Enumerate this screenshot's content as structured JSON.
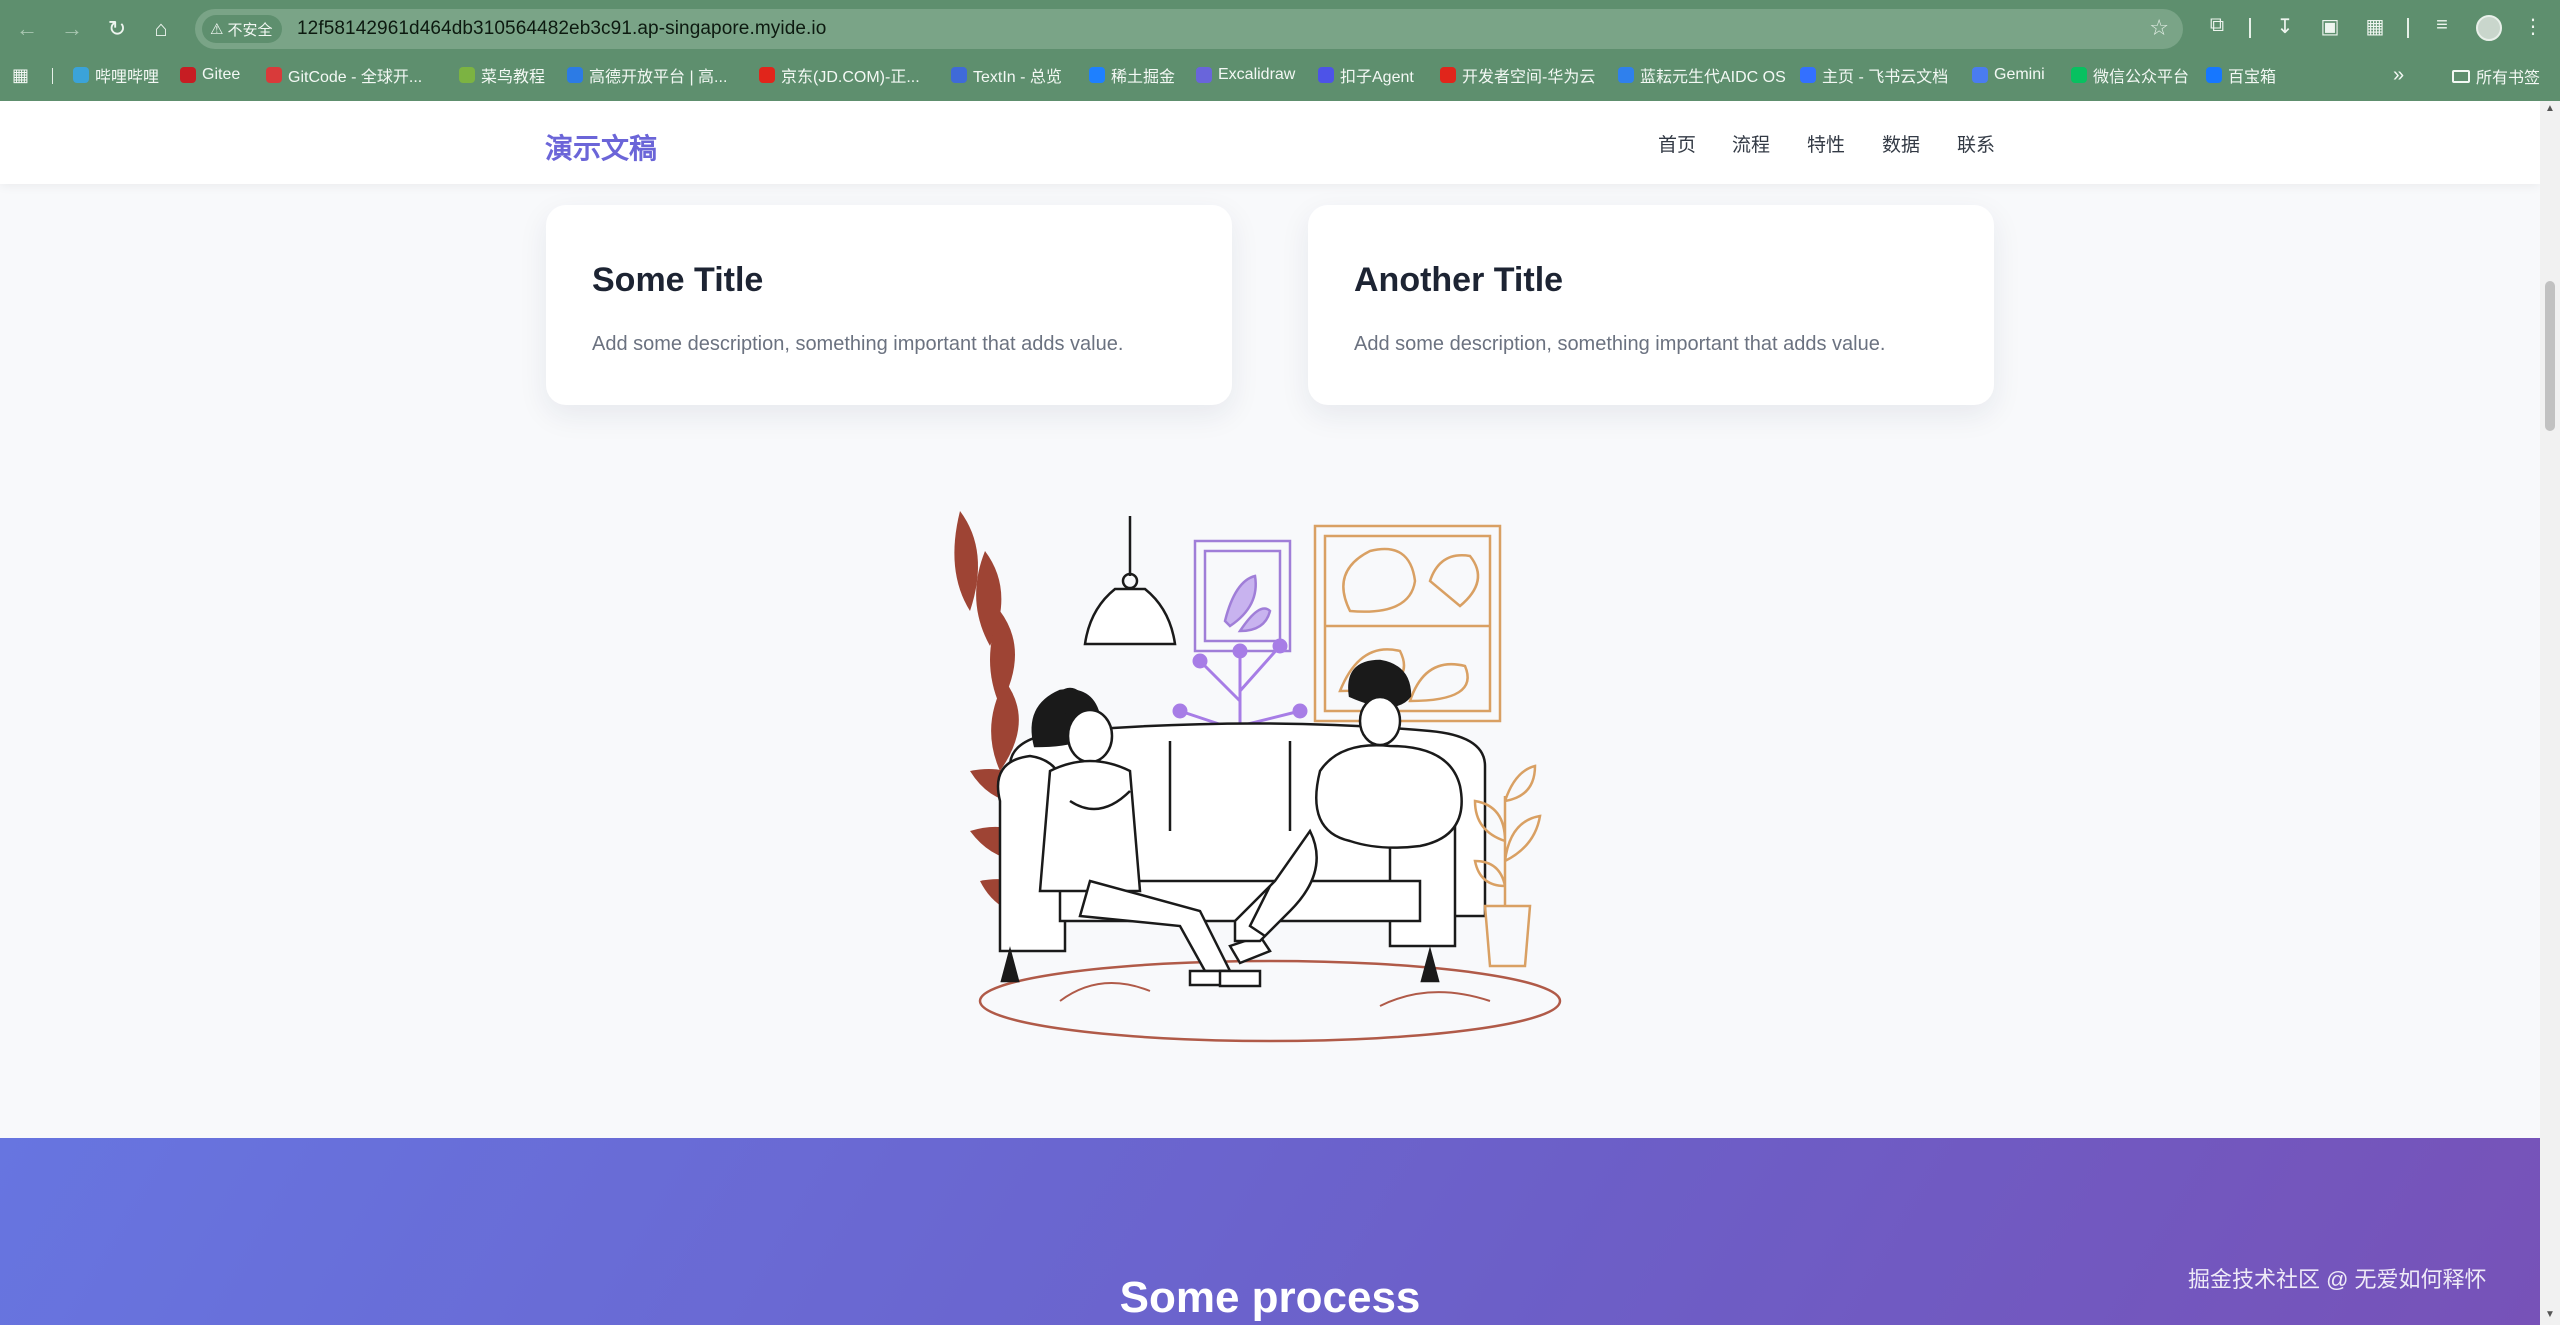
{
  "browser": {
    "security_label": "不安全",
    "url": "12f58142961d464db310564482eb3c91.ap-singapore.myide.io",
    "bookmarks": [
      {
        "label": "哔哩哔哩",
        "color": "#3ba3d9"
      },
      {
        "label": "Gitee",
        "color": "#c71d23"
      },
      {
        "label": "GitCode - 全球开...",
        "color": "#d93a3a"
      },
      {
        "label": "菜鸟教程",
        "color": "#7cb342"
      },
      {
        "label": "高德开放平台 | 高...",
        "color": "#2c7be5"
      },
      {
        "label": "京东(JD.COM)-正...",
        "color": "#e1251b"
      },
      {
        "label": "TextIn - 总览",
        "color": "#3f6ad8"
      },
      {
        "label": "稀土掘金",
        "color": "#1e80ff"
      },
      {
        "label": "Excalidraw",
        "color": "#6965db"
      },
      {
        "label": "扣子Agent",
        "color": "#4d53e8"
      },
      {
        "label": "开发者空间-华为云",
        "color": "#e1251b"
      },
      {
        "label": "蓝耘元生代AIDC OS",
        "color": "#2f80ed"
      },
      {
        "label": "主页 - 飞书云文档",
        "color": "#3370ff"
      },
      {
        "label": "Gemini",
        "color": "#4a7cf0"
      },
      {
        "label": "微信公众平台",
        "color": "#07c160"
      },
      {
        "label": "百宝箱",
        "color": "#1677ff"
      }
    ],
    "all_bookmarks_label": "所有书签"
  },
  "site": {
    "logo": "演示文稿",
    "nav": [
      "首页",
      "流程",
      "特性",
      "数据",
      "联系"
    ]
  },
  "cards": [
    {
      "title": "Some Title",
      "desc": "Add some description, something important that adds value."
    },
    {
      "title": "Another Title",
      "desc": "Add some description, something important that adds value."
    }
  ],
  "process": {
    "heading": "Some process"
  },
  "watermark": "掘金技术社区 @ 无爱如何释怀",
  "colors": {
    "accent": "#6b65d8",
    "gradient_start": "#6775e0",
    "gradient_end": "#7752b8",
    "chrome": "#5e8f6e"
  }
}
